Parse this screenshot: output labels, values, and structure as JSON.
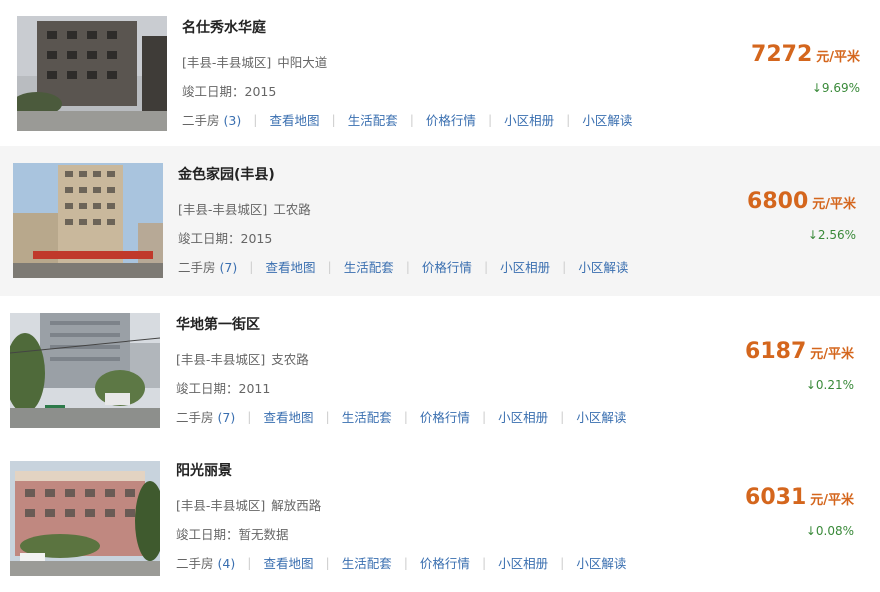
{
  "listings": [
    {
      "name": "名仕秀水华庭",
      "location": "[丰县-丰县城区]",
      "road": "中阳大道",
      "completed": "竣工日期：2015",
      "price": "7272",
      "unit": "元/平米",
      "change": "↓9.69%",
      "secondhand_label": "二手房",
      "secondhand_count": "(3)",
      "links": [
        "查看地图",
        "生活配套",
        "价格行情",
        "小区相册",
        "小区解读"
      ],
      "image_icon": "residential-building-photo"
    },
    {
      "name": "金色家园(丰县)",
      "location": "[丰县-丰县城区]",
      "road": "工农路",
      "completed": "竣工日期：2015",
      "price": "6800",
      "unit": "元/平米",
      "change": "↓2.56%",
      "secondhand_label": "二手房",
      "secondhand_count": "(7)",
      "links": [
        "查看地图",
        "生活配套",
        "价格行情",
        "小区相册",
        "小区解读"
      ],
      "image_icon": "highrise-building-photo"
    },
    {
      "name": "华地第一街区",
      "location": "[丰县-丰县城区]",
      "road": "支农路",
      "completed": "竣工日期：2011",
      "price": "6187",
      "unit": "元/平米",
      "change": "↓0.21%",
      "secondhand_label": "二手房",
      "secondhand_count": "(7)",
      "links": [
        "查看地图",
        "生活配套",
        "价格行情",
        "小区相册",
        "小区解读"
      ],
      "image_icon": "street-building-photo"
    },
    {
      "name": "阳光丽景",
      "location": "[丰县-丰县城区]",
      "road": "解放西路",
      "completed": "竣工日期：暂无数据",
      "price": "6031",
      "unit": "元/平米",
      "change": "↓0.08%",
      "secondhand_label": "二手房",
      "secondhand_count": "(4)",
      "links": [
        "查看地图",
        "生活配套",
        "价格行情",
        "小区相册",
        "小区解读"
      ],
      "image_icon": "apartment-building-photo"
    }
  ],
  "colors": {
    "price": "#d4661d",
    "link": "#3a6fb0",
    "change": "#3a8a3a",
    "alt_row_bg": "#f5f5f5"
  }
}
